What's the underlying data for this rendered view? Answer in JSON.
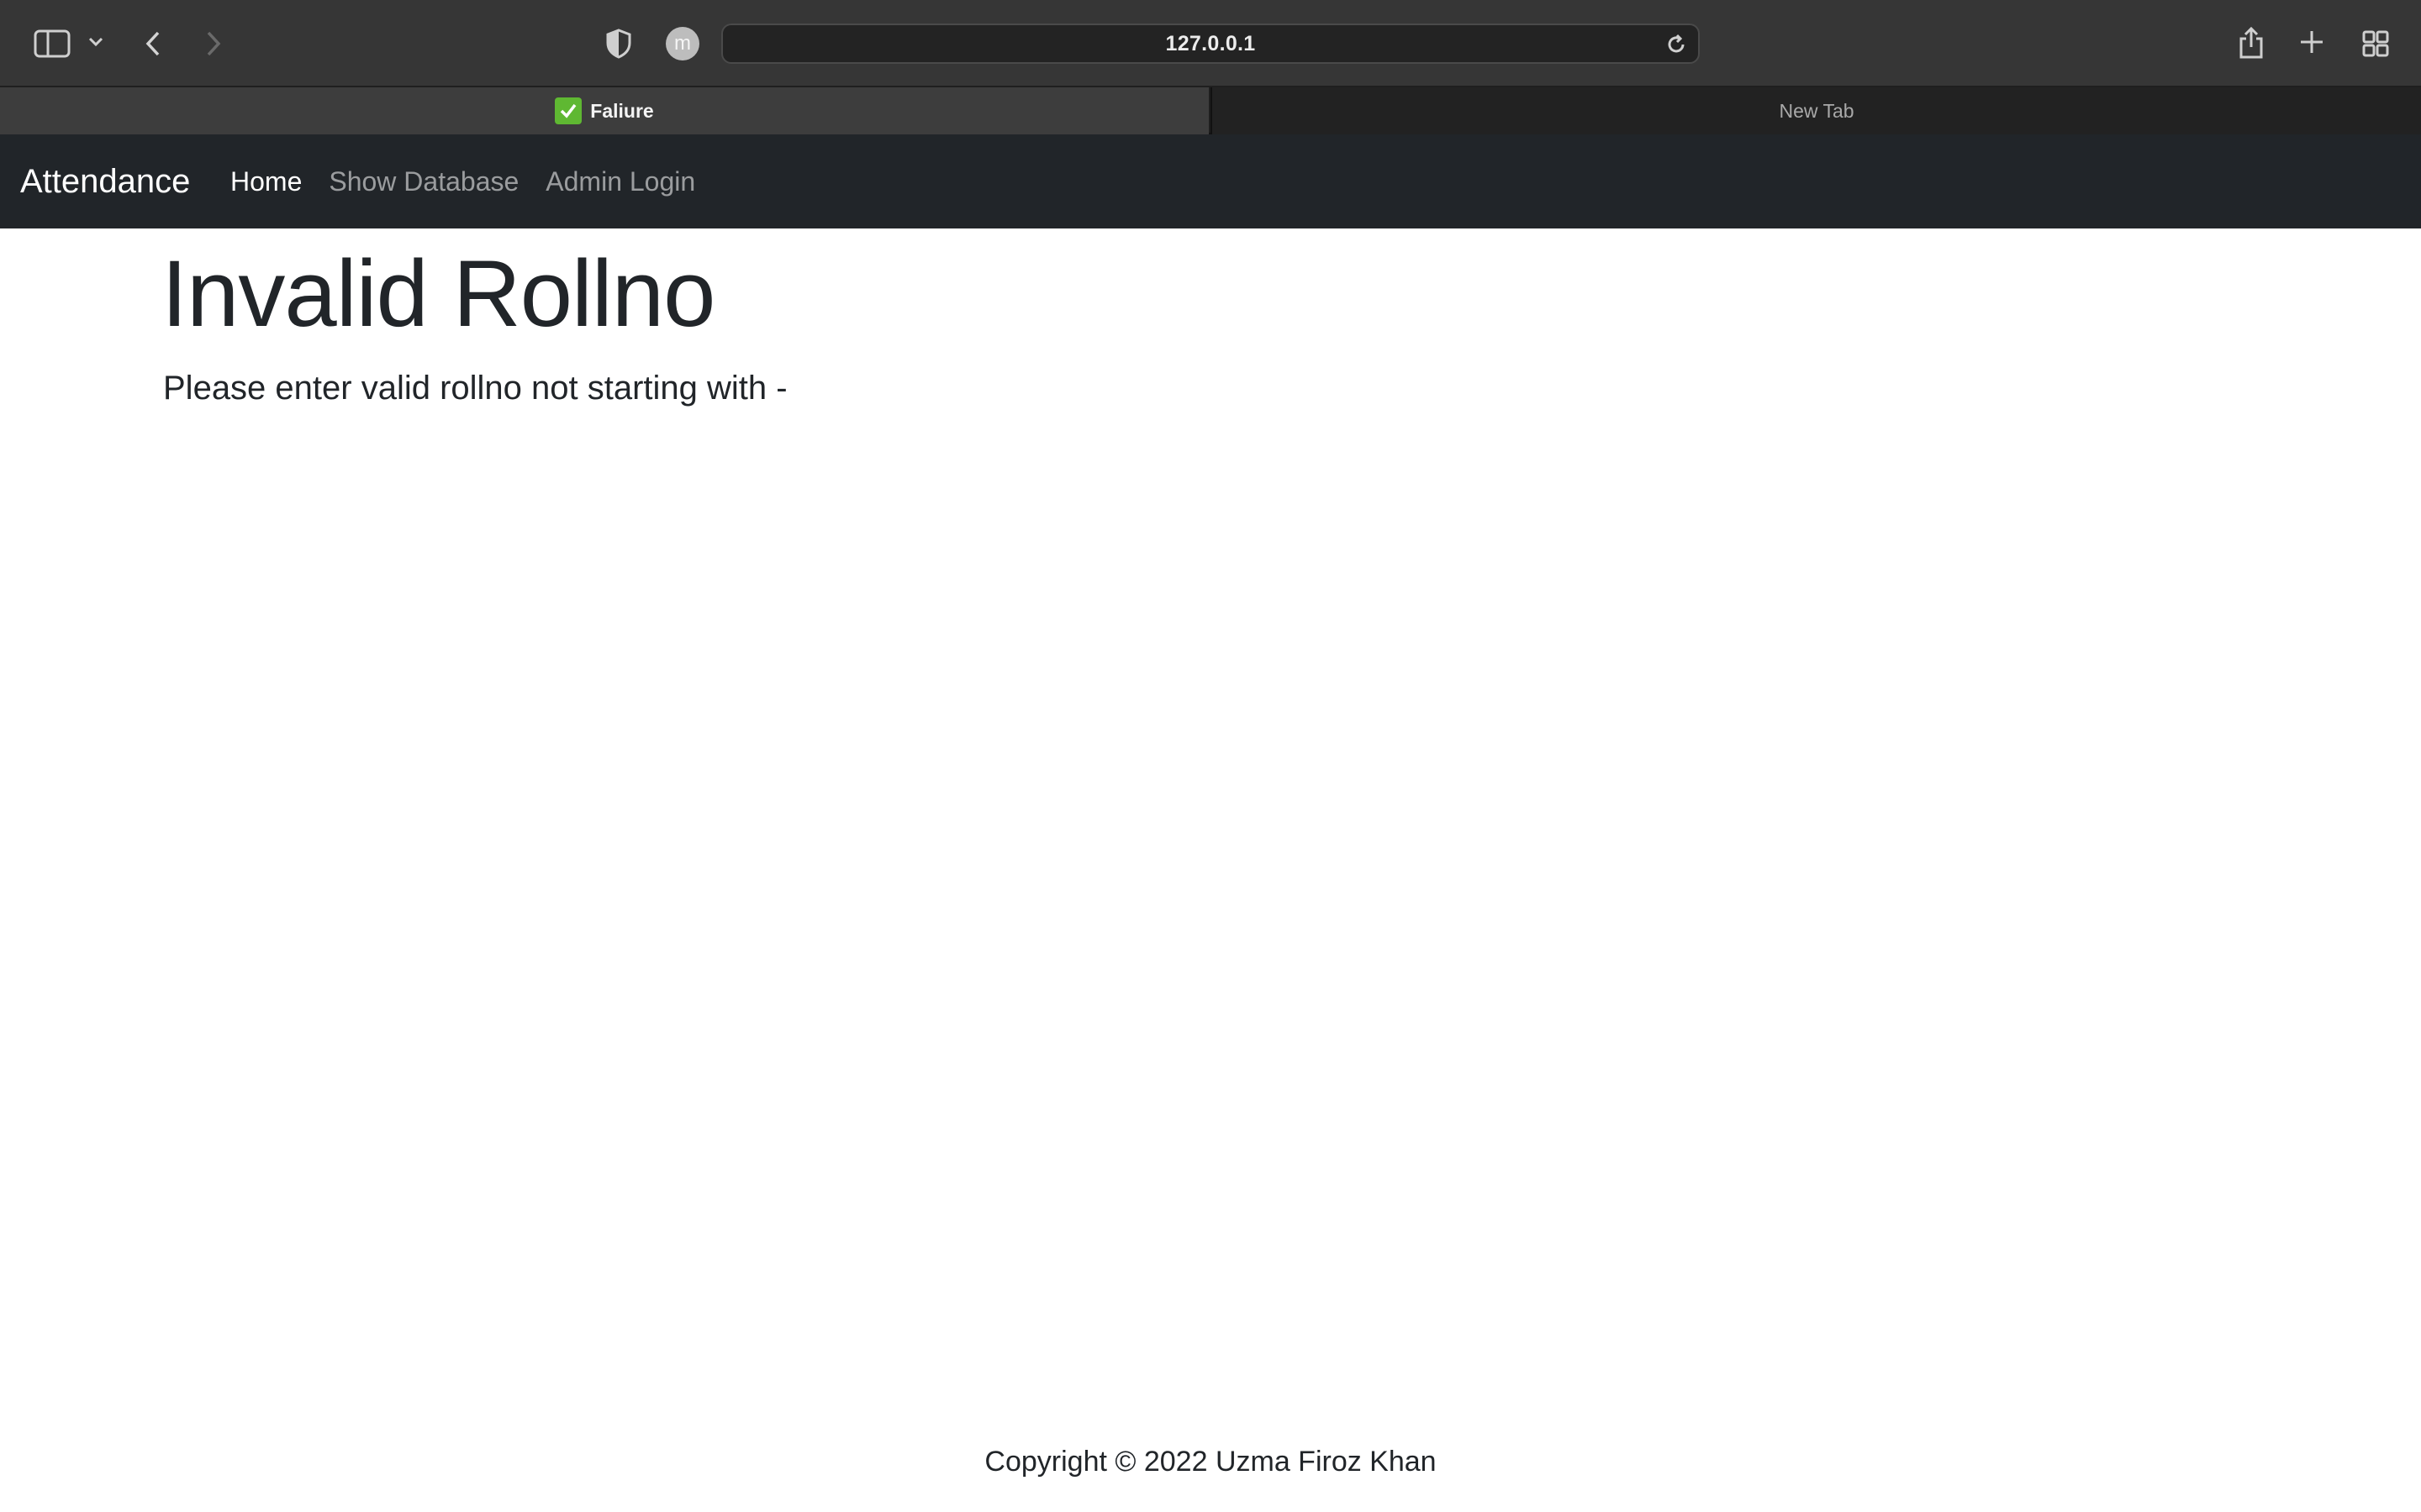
{
  "browser": {
    "address": "127.0.0.1",
    "avatar_letter": "m",
    "tabs": [
      {
        "title": "Faliure",
        "active": true,
        "favicon": "check-mark-icon"
      },
      {
        "title": "New Tab",
        "active": false
      }
    ]
  },
  "navbar": {
    "brand": "Attendance",
    "links": [
      {
        "label": "Home",
        "active": true
      },
      {
        "label": "Show Database",
        "active": false
      },
      {
        "label": "Admin Login",
        "active": false
      }
    ]
  },
  "main": {
    "heading": "Invalid Rollno",
    "message": "Please enter valid rollno not starting with -"
  },
  "footer": {
    "text": "Copyright © 2022   Uzma Firoz Khan"
  },
  "colors": {
    "navbar_bg": "#212529",
    "text": "#212529",
    "favicon_green": "#5fb832"
  }
}
